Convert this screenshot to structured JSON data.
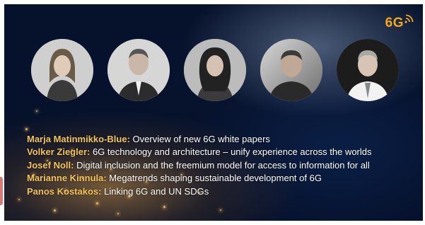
{
  "logo": {
    "text": "6G"
  },
  "speakers": [
    {
      "name": "Marja Matinmikko-Blue:",
      "topic": " Overview of new 6G white papers"
    },
    {
      "name": "Volker Ziegler:",
      "topic": " 6G technology and architecture – unify experience across the worlds"
    },
    {
      "name": "Josef Noll:",
      "topic": " Digital inclusion and the freemium model for access to information for all"
    },
    {
      "name": "Marianne Kinnula:",
      "topic": " Megatrends shaping sustainable development of 6G"
    },
    {
      "name": "Panos Kostakos:",
      "topic": " Linking 6G and UN SDGs"
    }
  ],
  "colors": {
    "name_accent": "#f3c45a",
    "logo_accent": "#f2a81d",
    "text": "#ffffff"
  },
  "icons": [
    "signal-icon"
  ]
}
